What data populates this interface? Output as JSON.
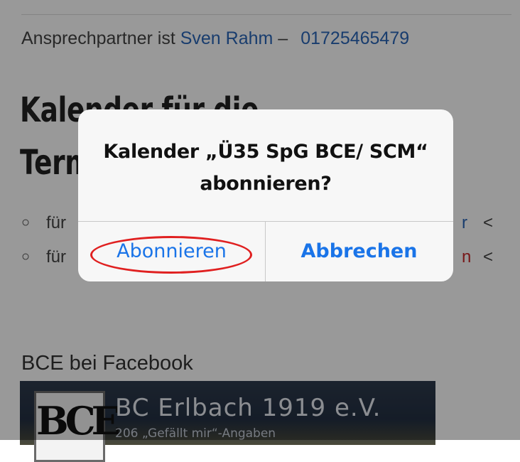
{
  "contact": {
    "prefix": "Ansprechpartner ist ",
    "name": "Sven Rahm",
    "dash": " –",
    "phone": "01725465479"
  },
  "calendar_heading": "Kalender für die Termine/Spiele der /",
  "bullets": [
    {
      "text": "für",
      "tail": "r",
      "lt": "<"
    },
    {
      "text": "für",
      "tail": "n",
      "lt": "<"
    }
  ],
  "facebook": {
    "heading": "BCE bei Facebook",
    "logo_text": "BCE",
    "page_name": "BC Erlbach 1919 e.V.",
    "likes": "206 „Gefällt mir“-Angaben"
  },
  "dialog": {
    "title": "Kalender „Ü35 SpG BCE/ SCM“ abonnieren?",
    "subscribe_label": "Abonnieren",
    "cancel_label": "Abbrechen"
  },
  "colors": {
    "link": "#2a66b8",
    "ios_blue": "#1a74e8",
    "annotation_red": "#e02020"
  }
}
